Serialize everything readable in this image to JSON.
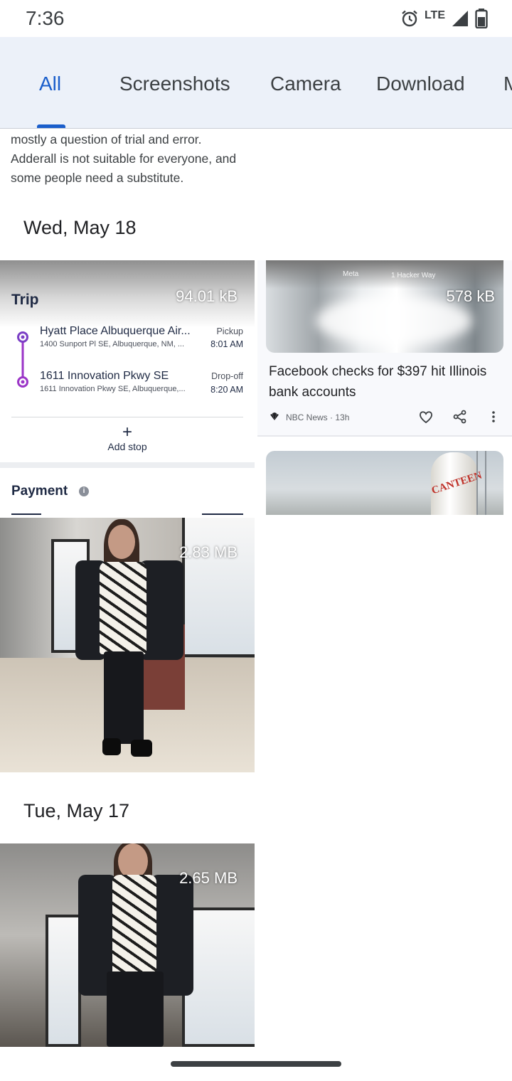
{
  "status_bar": {
    "time": "7:36",
    "network": "LTE"
  },
  "tabs": [
    {
      "label": "All",
      "active": true
    },
    {
      "label": "Screenshots",
      "active": false
    },
    {
      "label": "Camera",
      "active": false
    },
    {
      "label": "Download",
      "active": false
    },
    {
      "label": "M",
      "active": false
    }
  ],
  "snippet": {
    "text": "mostly a question of trial and error. Adderall is not suitable for everyone, and some people need a substitute."
  },
  "sections": [
    {
      "date": "Wed, May 18"
    },
    {
      "date": "Tue, May 17"
    }
  ],
  "trip_card": {
    "size": "94.01 kB",
    "title": "Trip",
    "pickup": {
      "name": "Hyatt Place Albuquerque Air...",
      "address": "1400 Sunport Pl SE, Albuquerque, NM, ...",
      "kind": "Pickup",
      "time": "8:01 AM"
    },
    "dropoff": {
      "name": "1611 Innovation Pkwy SE",
      "address": "1611 Innovation Pkwy SE, Albuquerque,...",
      "kind": "Drop-off",
      "time": "8:20 AM"
    },
    "add_stop": "Add stop",
    "payment": "Payment",
    "info_glyph": "i"
  },
  "news_card": {
    "size": "578 kB",
    "sign_meta": "Meta",
    "sign_street": "1 Hacker Way",
    "headline": "Facebook checks for $397 hit Illinois bank accounts",
    "source": "NBC News · 13h"
  },
  "news_card2": {
    "sign_text": "CANTEEN"
  },
  "photos": [
    {
      "size": "2.83 MB"
    },
    {
      "size": "2.65 MB"
    }
  ],
  "colors": {
    "accent": "#1a5ecb",
    "tab_bar": "#ecf1f9",
    "route_purple": "#9b35c7"
  }
}
